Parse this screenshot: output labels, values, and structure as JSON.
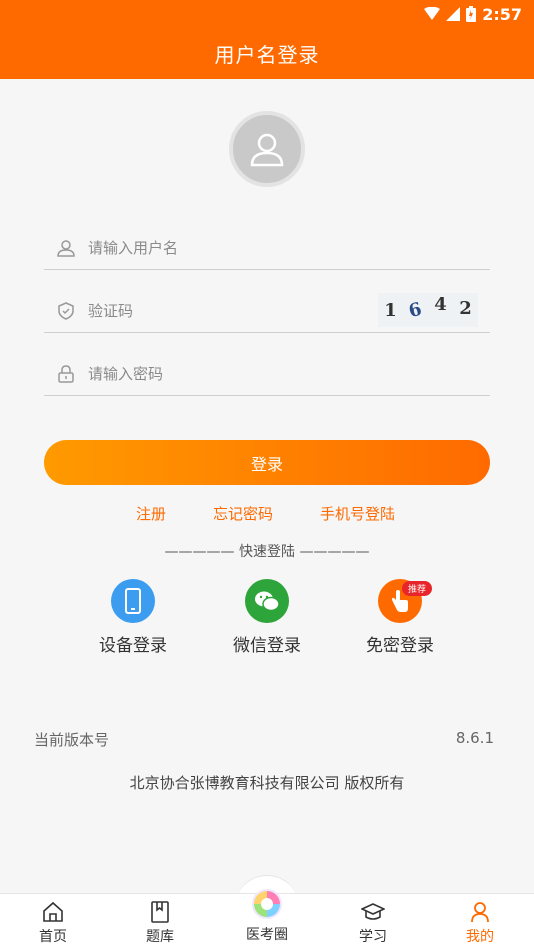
{
  "status": {
    "time": "2:57"
  },
  "header": {
    "title": "用户名登录"
  },
  "form": {
    "username_placeholder": "请输入用户名",
    "captcha_placeholder": "验证码",
    "captcha_chars": [
      "1",
      "6",
      "4",
      "2"
    ],
    "password_placeholder": "请输入密码",
    "login_label": "登录"
  },
  "links": {
    "register": "注册",
    "forgot": "忘记密码",
    "phone_login": "手机号登陆"
  },
  "quick_login": {
    "divider": "————— 快速登陆 —————",
    "items": [
      {
        "label": "设备登录",
        "icon": "phone-device-icon",
        "color": "#3c9cf0"
      },
      {
        "label": "微信登录",
        "icon": "wechat-icon",
        "color": "#2ea53a"
      },
      {
        "label": "免密登录",
        "icon": "tap-finger-icon",
        "color": "#ff6a00",
        "badge": "推荐"
      }
    ]
  },
  "version": {
    "label": "当前版本号",
    "value": "8.6.1"
  },
  "copyright": "北京协合张博教育科技有限公司 版权所有",
  "tabs": [
    {
      "label": "首页",
      "icon": "home-icon"
    },
    {
      "label": "题库",
      "icon": "book-icon"
    },
    {
      "label": "医考圈",
      "icon": "circle-logo-icon"
    },
    {
      "label": "学习",
      "icon": "graduation-cap-icon"
    },
    {
      "label": "我的",
      "icon": "person-icon",
      "active": true
    }
  ],
  "colors": {
    "accent": "#ff6a00"
  }
}
